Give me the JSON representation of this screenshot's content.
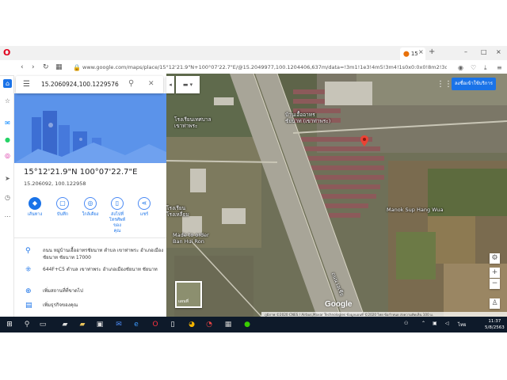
{
  "browser": {
    "tab_title": "15",
    "tab_close": "×",
    "new_tab": "+",
    "url": "www.google.com/maps/place/15°12'21.9\"N+100°07'22.7\"E/@15.2049977,100.1204406,637m/data=!3m1!1e3!4m5!3m4!1s0x0:0x0!8m2!3d15.2060924!4d100.1",
    "win_controls": [
      "–",
      "□",
      "×"
    ]
  },
  "search": {
    "query": "15.2060924,100.1229576"
  },
  "place": {
    "title": "15°12'21.9\"N 100°07'22.7\"E",
    "subtitle": "15.206092, 100.122958",
    "actions": [
      {
        "label": "เส้นทาง",
        "icon": "directions-icon"
      },
      {
        "label": "บันทึก",
        "icon": "bookmark-icon"
      },
      {
        "label": "ใกล้เคียง",
        "icon": "nearby-icon"
      },
      {
        "label": "ส่งไปที่\nโทรศัพท์ของ\nคุณ",
        "icon": "phone-icon"
      },
      {
        "label": "แชร์",
        "icon": "share-icon"
      }
    ],
    "info": [
      {
        "icon": "location-pin-icon",
        "text": "ถนน หมู่บ้านเอื้ออาทรชัยนาท ตำบล เขาท่าพระ อำเภอเมืองชัยนาท ชัยนาท 17000"
      },
      {
        "icon": "plus-code-icon",
        "text": "644F+C5 ตำบล เขาท่าพระ อำเภอเมืองชัยนาท ชัยนาท"
      },
      {
        "icon": "add-place-icon",
        "text": "เพิ่มสถานที่ที่ขาดไป"
      },
      {
        "icon": "business-icon",
        "text": "เพิ่มธุรกิจของคุณ"
      }
    ]
  },
  "map": {
    "signin_label": "ลงชื่อเข้าใช้บริการ",
    "labels": [
      {
        "text": "โรงเรียนเทศบาล\nเขาท่าพระ",
        "key": "school"
      },
      {
        "text": "บ้านเอื้ออาทร\nชัยนาท (เขาท่าพระ)",
        "key": "village"
      },
      {
        "text": "Manok Sup Hang Wua",
        "key": "manok"
      },
      {
        "text": "โรงเรียน\nโรงเหลี่ยม",
        "key": "school2"
      },
      {
        "text": "Made to order\nBan Hui Ron",
        "key": "shop"
      }
    ],
    "road_label": "ถนน เอเชีย",
    "satellite_label": "แผนที่",
    "google_logo": "Google",
    "attribution": "ภูมิภาพ ©2020 CNES / Airbus,Maxar Technologies ข้อมูลแผนที่ ©2020   ไทย   ข้อกำหนด   ส่งความคิดเห็น   100 ม."
  },
  "taskbar": {
    "time": "11:37",
    "date": "5/8/2563",
    "lang": "ไทย"
  },
  "colors": {
    "accent": "#1a73e8",
    "pin": "#ea4335",
    "opera": "#e0001b",
    "taskbar": "#0e1a2a"
  }
}
